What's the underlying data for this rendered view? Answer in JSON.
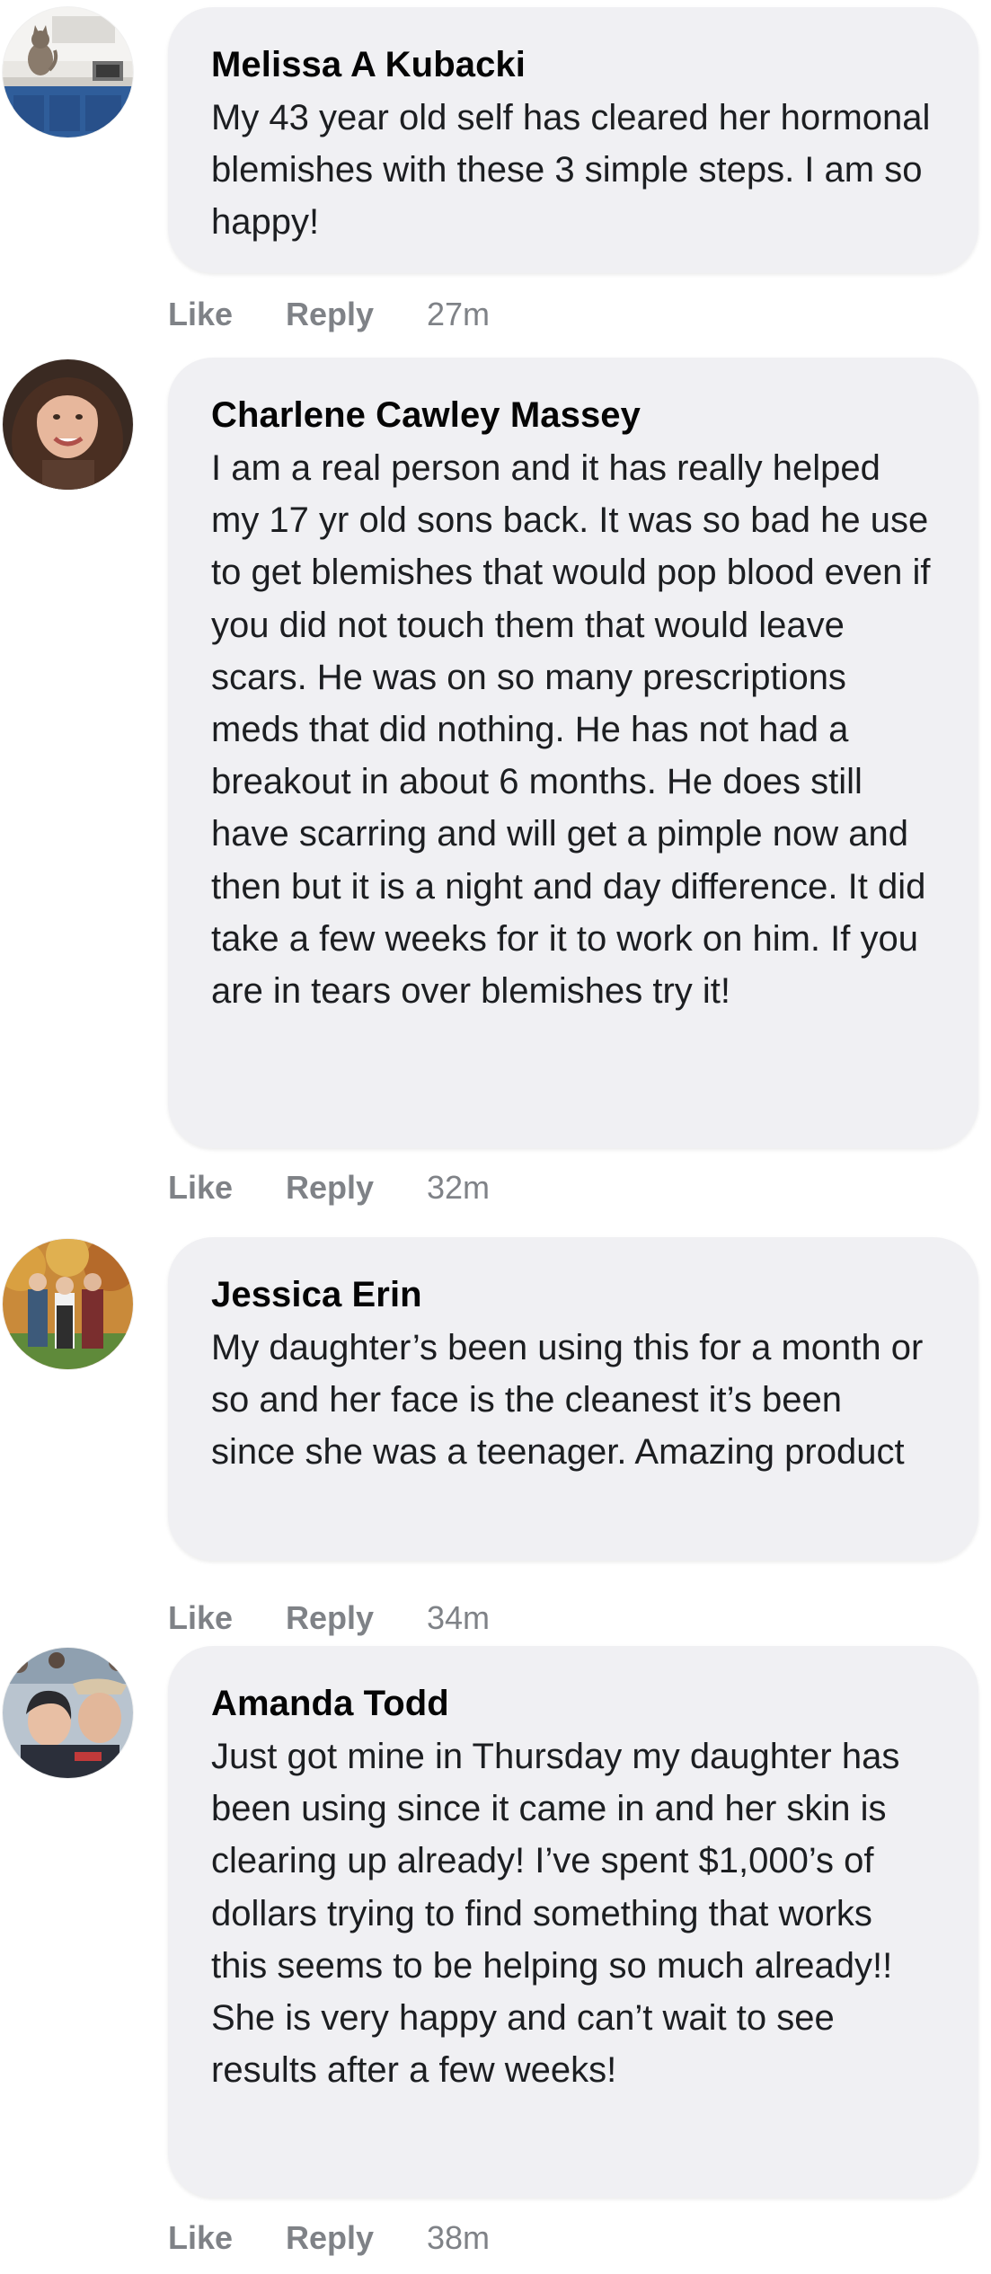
{
  "comments": [
    {
      "author": "Melissa A Kubacki",
      "text": "My 43 year old self has cleared her hormonal blemishes with these 3 simple steps. I am so happy!",
      "like_label": "Like",
      "reply_label": "Reply",
      "time": "27m",
      "avatar_icon": "profile-photo-kitchen-cat"
    },
    {
      "author": "Charlene Cawley Massey",
      "text": "I am a real person and it has really helped my 17 yr old sons back. It was so bad he use to get blemishes that would pop blood even if you did not touch them that would leave scars. He was on so many prescriptions meds that did nothing. He has not had a breakout in about 6 months. He does still have scarring and will get a pimple now and then but it is a night and day difference. It did take a few weeks for it to work on him. If you are in tears over blemishes try it!",
      "like_label": "Like",
      "reply_label": "Reply",
      "time": "32m",
      "avatar_icon": "profile-photo-woman-smiling"
    },
    {
      "author": "Jessica Erin",
      "text": "My daughter’s been using this for a month or so and her face is the cleanest it’s been since she was a teenager. Amazing product",
      "like_label": "Like",
      "reply_label": "Reply",
      "time": "34m",
      "avatar_icon": "profile-photo-family-autumn"
    },
    {
      "author": "Amanda Todd",
      "text": "Just got mine in Thursday my daughter has been using since it came in and her skin is clearing up already! I’ve spent $1,000’s of dollars trying to find something that works this seems to be helping so much already!! She is very happy and can’t wait to see results after a few weeks!",
      "like_label": "Like",
      "reply_label": "Reply",
      "time": "38m",
      "avatar_icon": "profile-photo-couple-selfie"
    }
  ],
  "colors": {
    "bubble_background": "#f0f0f3",
    "author_text": "#050505",
    "body_text": "#1c1e21",
    "action_text": "#7f8287"
  }
}
